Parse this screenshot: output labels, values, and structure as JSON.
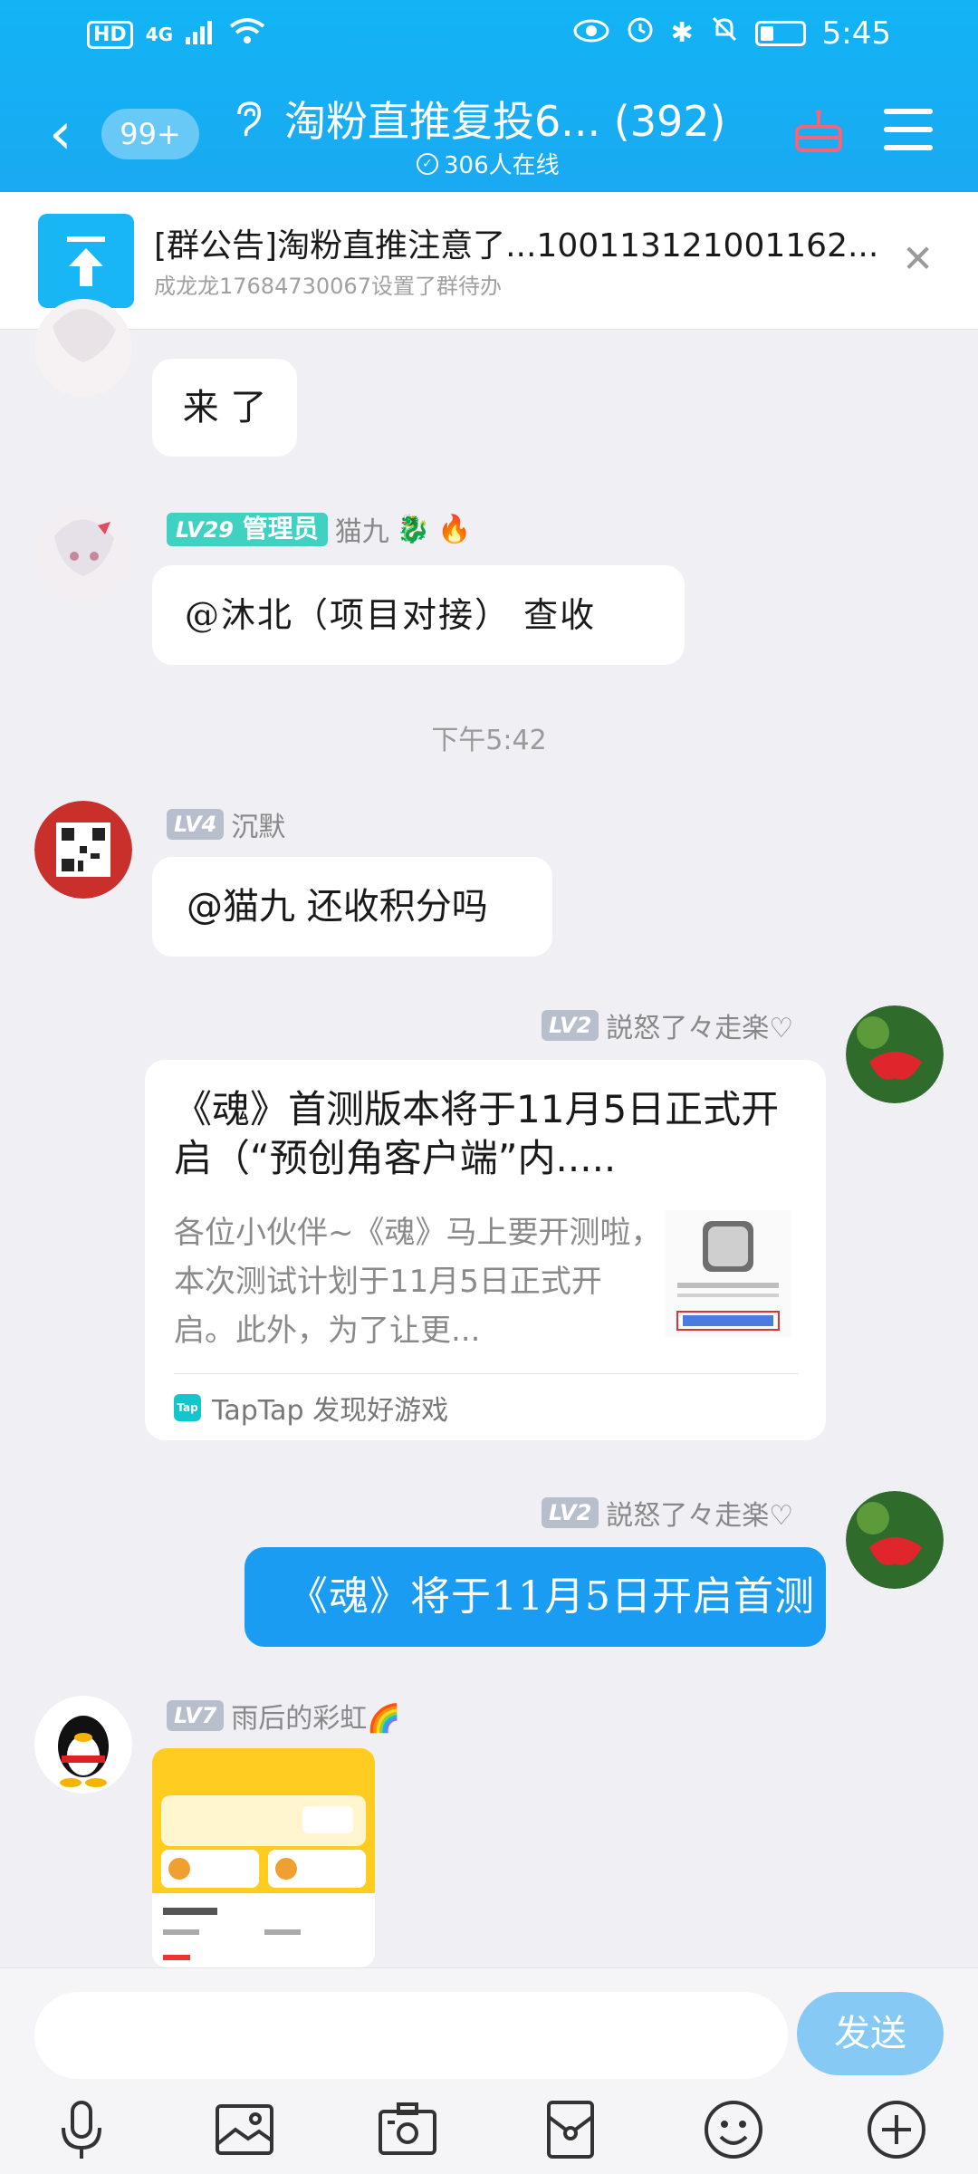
{
  "status": {
    "hd": "HD",
    "network": "4G",
    "time": "5:45"
  },
  "nav": {
    "back_badge": "99+",
    "title": "淘粉直推复投6... (392)",
    "online": "306人在线"
  },
  "announcement": {
    "title": "[群公告]淘粉直推注意了...100113121001162...",
    "subtitle": "成龙龙17684730067设置了群待办"
  },
  "messages": [
    {
      "text": "来 了"
    },
    {
      "level": "LV29",
      "role": "管理员",
      "name": "猫九",
      "text": "@沐北（项目对接） 查收"
    },
    {
      "level": "LV4",
      "name": "沉默",
      "text": "@猫九 还收积分吗"
    },
    {
      "level": "LV2",
      "name": "説怒了々走楽♡"
    },
    {
      "level": "LV2",
      "name": "説怒了々走楽♡",
      "text": "《魂》将于11月5日开启首测"
    },
    {
      "level": "LV7",
      "name": "雨后的彩虹🌈"
    }
  ],
  "time_divider": "下午5:42",
  "link_card": {
    "title": "《魂》首测版本将于11月5日正式开启（“预创角客户端”内.....",
    "description": "各位小伙伴~《魂》马上要开测啦，本次测试计划于11月5日正式开启。此外，为了让更...",
    "source": "TapTap 发现好游戏",
    "logo": "Tap"
  },
  "input": {
    "send": "发送"
  },
  "toolbar": [
    "mic-icon",
    "image-icon",
    "camera-icon",
    "red-packet-icon",
    "emoji-icon",
    "plus-icon"
  ],
  "colors": {
    "header": "#12b4f5",
    "accent": "#1a9cf3",
    "send_disabled": "#86c9f5"
  }
}
